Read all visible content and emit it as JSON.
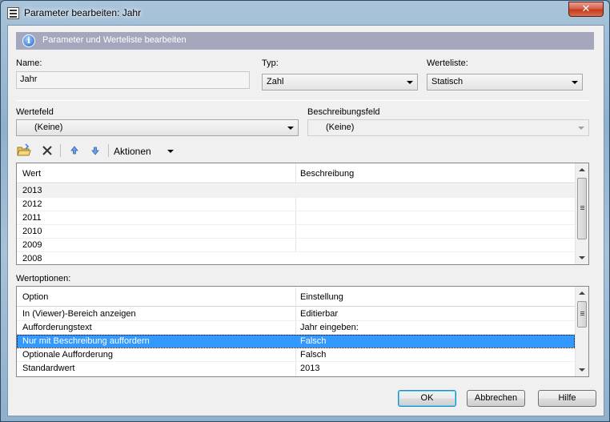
{
  "window": {
    "title": "Parameter bearbeiten: Jahr",
    "close_label": "✕"
  },
  "banner": {
    "text": "Parameter und Werteliste bearbeiten"
  },
  "fields": {
    "name_label": "Name:",
    "name_value": "Jahr",
    "type_label": "Typ:",
    "type_value": "Zahl",
    "valuelist_label": "Werteliste:",
    "valuelist_value": "Statisch",
    "valuefield_label": "Wertefeld",
    "valuefield_value": "(Keine)",
    "descfield_label": "Beschreibungsfeld",
    "descfield_value": "(Keine)"
  },
  "toolbar": {
    "actions_label": "Aktionen"
  },
  "values_grid": {
    "columns": [
      "Wert",
      "Beschreibung"
    ],
    "rows": [
      {
        "wert": "2013",
        "beschreibung": ""
      },
      {
        "wert": "2012",
        "beschreibung": ""
      },
      {
        "wert": "2011",
        "beschreibung": ""
      },
      {
        "wert": "2010",
        "beschreibung": ""
      },
      {
        "wert": "2009",
        "beschreibung": ""
      },
      {
        "wert": "2008",
        "beschreibung": ""
      }
    ]
  },
  "options": {
    "section_label": "Wertoptionen:",
    "columns": [
      "Option",
      "Einstellung"
    ],
    "rows": [
      {
        "option": "In (Viewer)-Bereich anzeigen",
        "setting": "Editierbar"
      },
      {
        "option": "Aufforderungstext",
        "setting": "Jahr eingeben:"
      },
      {
        "option": "Nur mit Beschreibung auffordern",
        "setting": "Falsch"
      },
      {
        "option": "Optionale Aufforderung",
        "setting": "Falsch"
      },
      {
        "option": "Standardwert",
        "setting": "2013"
      }
    ]
  },
  "buttons": {
    "ok": "OK",
    "cancel": "Abbrechen",
    "help": "Hilfe"
  },
  "colors": {
    "selection": "#3399ff",
    "banner": "#a5a8bd"
  }
}
